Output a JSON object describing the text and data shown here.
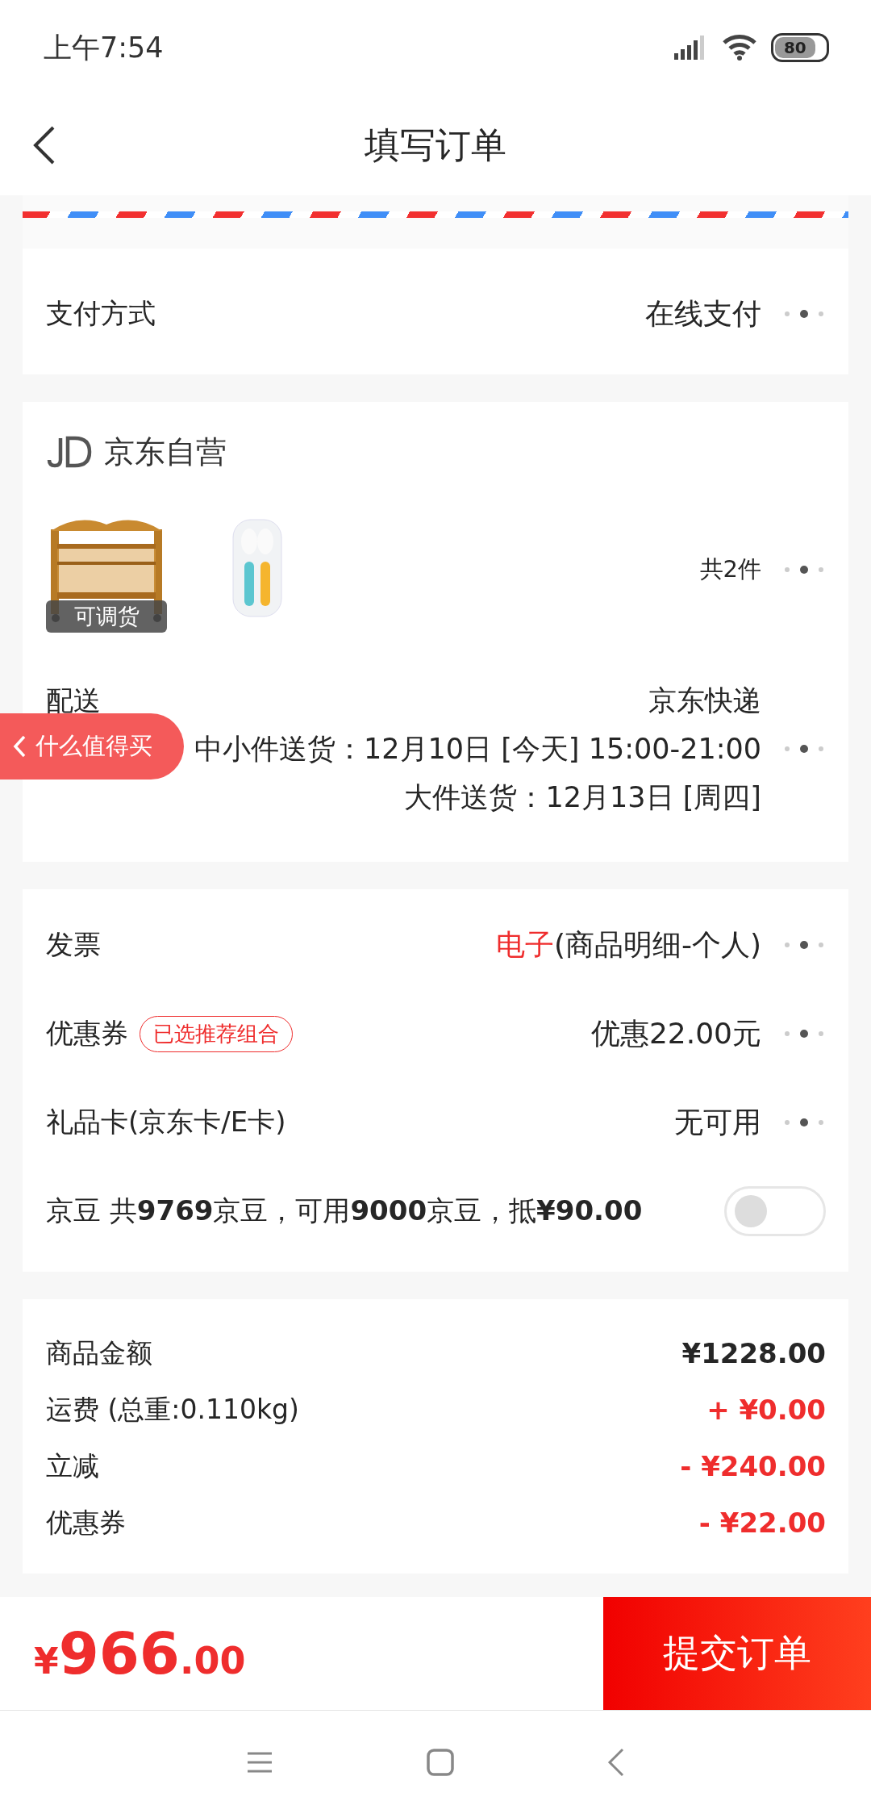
{
  "status_bar": {
    "time": "上午7:54",
    "battery": "80"
  },
  "header": {
    "title": "填写订单"
  },
  "payment": {
    "label": "支付方式",
    "value": "在线支付"
  },
  "shop": {
    "name": "京东自营",
    "products": [
      {
        "kind": "picture",
        "badge": "可调货"
      },
      {
        "kind": "picture"
      }
    ],
    "count": "共2件",
    "delivery": {
      "label": "配送",
      "carrier": "京东快递",
      "lines": [
        "中小件送货：12月10日 [今天] 15:00-21:00",
        "大件送货：12月13日 [周四]"
      ]
    }
  },
  "floating_tab": {
    "label": "什么值得买"
  },
  "options": [
    {
      "kind": "invoice",
      "label": "发票",
      "highlight": "电子",
      "value": "(商品明细-个人)"
    },
    {
      "kind": "coupon",
      "label": "优惠券",
      "tag": "已选推荐组合",
      "value": "优惠22.00元"
    },
    {
      "kind": "plain",
      "label": "礼品卡(京东卡/E卡)",
      "value": "无可用"
    },
    {
      "kind": "toggle",
      "label": "京豆 共**9769**京豆，可用**9000**京豆，抵**¥90.00**",
      "on": false
    }
  ],
  "summary": [
    {
      "label": "商品金额",
      "value": "¥1228.00",
      "kind": "normal"
    },
    {
      "label": "运费 (总重:0.110kg)",
      "value": "+ ¥0.00",
      "kind": "red"
    },
    {
      "label": "立减",
      "value": "- ¥240.00",
      "kind": "red"
    },
    {
      "label": "优惠券",
      "value": "- ¥22.00",
      "kind": "red"
    }
  ],
  "footer": {
    "currency": "¥",
    "integer": "966",
    "decimals": ".00",
    "submit": "提交订单"
  }
}
